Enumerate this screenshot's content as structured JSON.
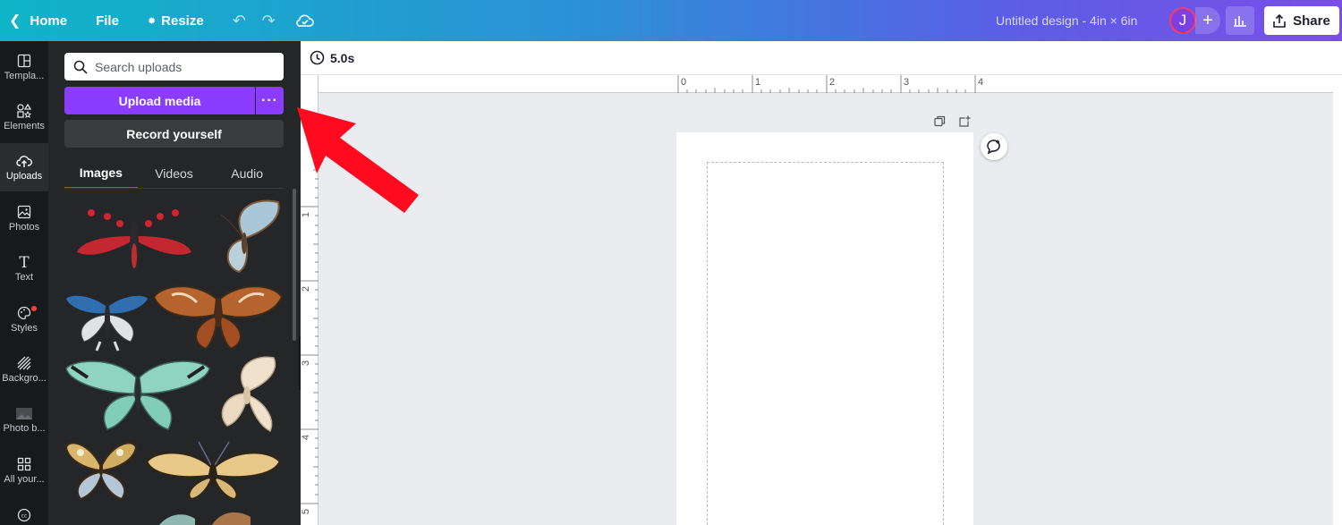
{
  "topbar": {
    "home_label": "Home",
    "file_label": "File",
    "resize_label": "Resize",
    "title": "Untitled design - 4in × 6in",
    "avatar_initial": "J",
    "share_label": "Share"
  },
  "rail": {
    "items": [
      {
        "label": "Templa...",
        "icon": "layout-icon"
      },
      {
        "label": "Elements",
        "icon": "shapes-icon"
      },
      {
        "label": "Uploads",
        "icon": "cloud-upload-icon"
      },
      {
        "label": "Photos",
        "icon": "image-icon"
      },
      {
        "label": "Text",
        "icon": "text-icon"
      },
      {
        "label": "Styles",
        "icon": "palette-icon"
      },
      {
        "label": "Backgro...",
        "icon": "background-icon"
      },
      {
        "label": "Photo b...",
        "icon": "photo-background-icon"
      },
      {
        "label": "All your...",
        "icon": "apps-grid-icon"
      }
    ]
  },
  "panel": {
    "search_placeholder": "Search uploads",
    "upload_label": "Upload media",
    "more_label": "···",
    "record_label": "Record yourself",
    "tabs": [
      "Images",
      "Videos",
      "Audio"
    ]
  },
  "canvas": {
    "duration": "5.0s",
    "ruler_h": [
      "0",
      "1",
      "2",
      "3",
      "4"
    ],
    "ruler_v": [
      "1",
      "2",
      "3",
      "4",
      "5"
    ]
  },
  "colors": {
    "accent": "#8b3dff",
    "arrow": "#ff0a1f"
  }
}
